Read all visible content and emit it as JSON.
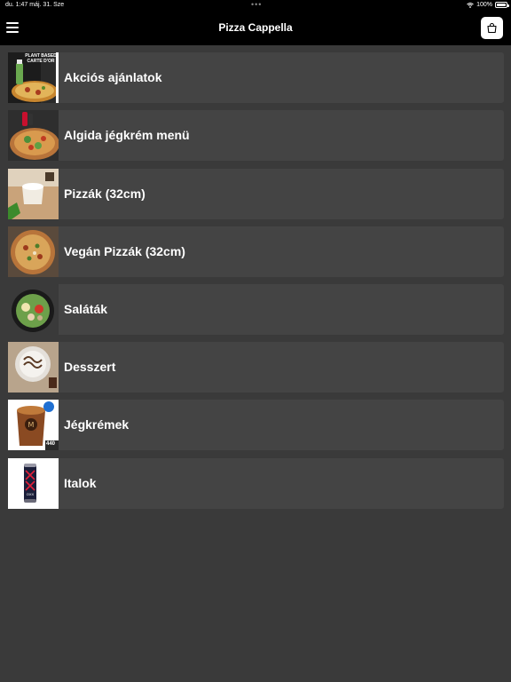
{
  "status": {
    "time": "du. 1:47",
    "date": "máj. 31. Sze",
    "dots": "•••",
    "battery": "100%"
  },
  "nav": {
    "title": "Pizza Cappella",
    "menu_icon": "hamburger-menu-icon",
    "cart_icon": "shopping-bag-icon"
  },
  "categories": [
    {
      "label": "Akciós ajánlatok",
      "image": "promo-pizza-drink-thumbnail",
      "badge": "PLANT BASED CARTE D'OR"
    },
    {
      "label": "Algida jégkrém menü",
      "image": "pizza-salad-drink-thumbnail"
    },
    {
      "label": "Pizzák (32cm)",
      "image": "ice-cream-cup-thumbnail"
    },
    {
      "label": "Vegán Pizzák (32cm)",
      "image": "vegan-pizza-thumbnail"
    },
    {
      "label": "Saláták",
      "image": "salad-bowl-thumbnail"
    },
    {
      "label": "Desszert",
      "image": "dessert-thumbnail"
    },
    {
      "label": "Jégkrémek",
      "image": "magnum-ice-cream-thumbnail",
      "badge": "440"
    },
    {
      "label": "Italok",
      "image": "energy-drink-can-thumbnail",
      "badge": "OXX"
    }
  ]
}
